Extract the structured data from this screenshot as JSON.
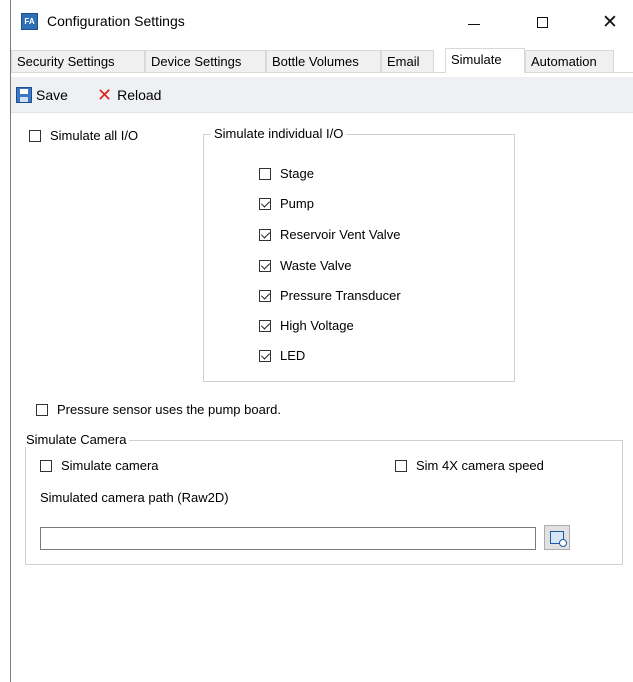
{
  "window": {
    "title": "Configuration Settings",
    "icon_name": "app-icon",
    "icon_text": "FA",
    "controls": {
      "minimize": "minimize-icon",
      "maximize": "maximize-icon",
      "close": "✕"
    }
  },
  "tabs": [
    {
      "label": "Security Settings"
    },
    {
      "label": "Device Settings"
    },
    {
      "label": "Bottle Volumes"
    },
    {
      "label": "Email"
    },
    {
      "label": "Simulate"
    },
    {
      "label": "Automation"
    }
  ],
  "active_tab": "Simulate",
  "toolbar": {
    "save_label": "Save",
    "reload_label": "Reload",
    "reload_icon": "✕"
  },
  "simulate_all": {
    "label": "Simulate all I/O",
    "checked": false
  },
  "individual_group": {
    "title": "Simulate individual I/O",
    "items": [
      {
        "label": "Stage",
        "checked": false
      },
      {
        "label": "Pump",
        "checked": true
      },
      {
        "label": "Reservoir Vent Valve",
        "checked": true
      },
      {
        "label": "Waste Valve",
        "checked": true
      },
      {
        "label": "Pressure Transducer",
        "checked": true
      },
      {
        "label": "High Voltage",
        "checked": true
      },
      {
        "label": "LED",
        "checked": true
      }
    ]
  },
  "pressure_sensor": {
    "label": "Pressure sensor uses the pump board.",
    "checked": false
  },
  "camera_group": {
    "title": "Simulate Camera",
    "simulate_camera": {
      "label": "Simulate camera",
      "checked": false
    },
    "sim_4x": {
      "label": "Sim 4X camera speed",
      "checked": false
    },
    "path_label": "Simulated camera path (Raw2D)",
    "path_value": ""
  },
  "colors": {
    "accent": "#2f6fb5",
    "reload": "#e0231e",
    "toolbar_bg": "#eef0f4"
  }
}
